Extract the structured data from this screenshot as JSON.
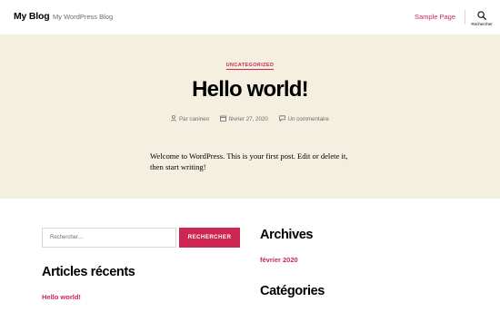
{
  "header": {
    "site_title": "My Blog",
    "site_description": "My WordPress Blog",
    "nav": [
      {
        "label": "Sample Page"
      }
    ],
    "search_toggle_label": "Rechercher",
    "accent_color": "#cd2653"
  },
  "post": {
    "category": "UNCATEGORIZED",
    "title": "Hello world!",
    "meta": {
      "author": "Par canineo",
      "date": "février 27, 2020",
      "comments": "Un commentaire"
    },
    "content": "Welcome to WordPress. This is your first post. Edit or delete it, then start writing!",
    "background_color": "#f5efe0"
  },
  "widgets": {
    "search": {
      "placeholder": "Rechercher…",
      "button_label": "RECHERCHER"
    },
    "recent_posts": {
      "title": "Articles récents",
      "items": [
        {
          "label": "Hello world!"
        }
      ]
    },
    "archives": {
      "title": "Archives",
      "items": [
        {
          "label": "février 2020"
        }
      ]
    },
    "categories": {
      "title": "Catégories"
    }
  },
  "icons": {
    "search": "search-icon",
    "author": "person-icon",
    "date": "calendar-icon",
    "comments": "comment-bubble-icon"
  }
}
